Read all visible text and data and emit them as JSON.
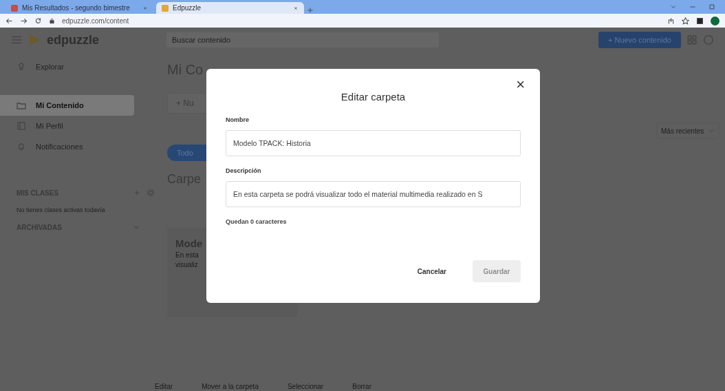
{
  "browser": {
    "tabs": [
      {
        "title": "Mis Resultados - segundo bimestre",
        "selected": false
      },
      {
        "title": "Edpuzzle",
        "selected": true
      }
    ],
    "address": "edpuzzle.com/content"
  },
  "header": {
    "logo": "edpuzzle",
    "search": {
      "placeholder": "Buscar contenido"
    },
    "new_button": "+ Nuevo contenido"
  },
  "sidebar": {
    "items": [
      {
        "label": "Explorar",
        "selected": false
      },
      {
        "label": "Mi Contenido",
        "selected": true
      },
      {
        "label": "Mi Perfil",
        "selected": false
      },
      {
        "label": "Notificaciones",
        "selected": false
      }
    ],
    "classes_title": "MIS CLASES",
    "classes_empty": "No tienes clases activas todavía",
    "archived": "ARCHIVADAS"
  },
  "main": {
    "title": "Mi Co",
    "add_button": "+ Nu",
    "filter": "Todo",
    "section": "Carpe",
    "sort": "Más recientes",
    "card": {
      "title": "Mode",
      "lines": [
        "En esta",
        "visualiz"
      ]
    },
    "actions": [
      "Editar",
      "Mover a la carpeta",
      "Seleccionar",
      "Borrar"
    ]
  },
  "dialog": {
    "title": "Editar carpeta",
    "close": "×",
    "fields": [
      {
        "label": "Nombre",
        "value": "Modelo TPACK: Historia"
      },
      {
        "label": "Descripción",
        "value": "En esta carpeta se podrá visualizar todo el material multimedia realizado en S"
      }
    ],
    "counter": "Quedan 0 caracteres",
    "buttons": [
      {
        "label": "Cancelar",
        "disabled": false
      },
      {
        "label": "Guardar",
        "disabled": true
      }
    ]
  }
}
